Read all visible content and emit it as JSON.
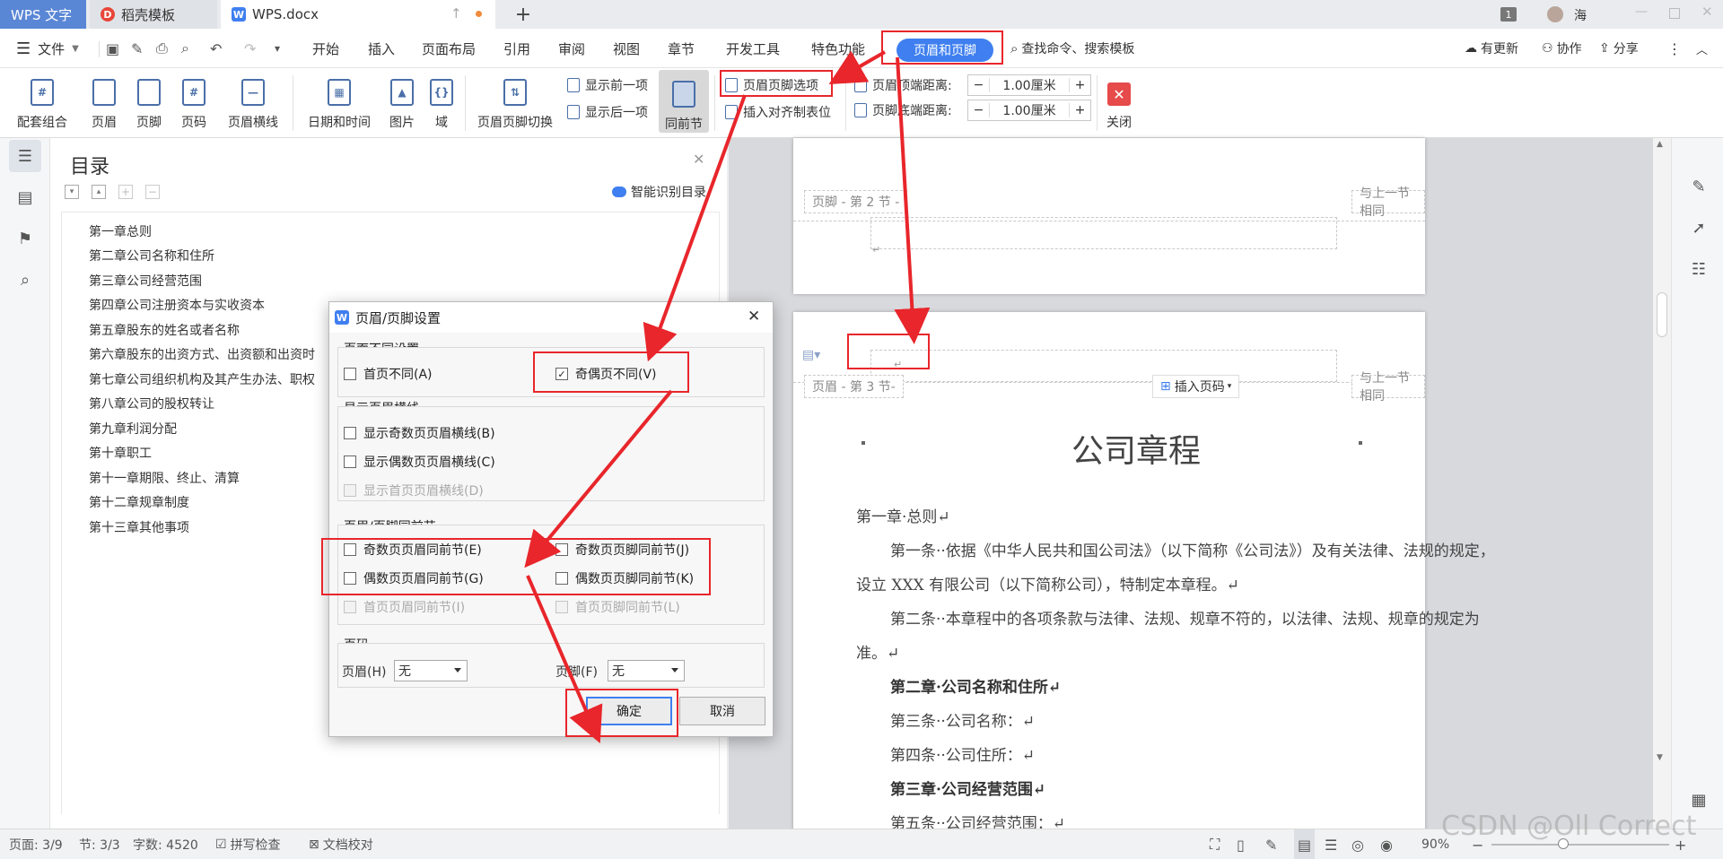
{
  "titlebar": {
    "tabs": [
      {
        "label": "WPS 文字"
      },
      {
        "label": "稻壳模板"
      },
      {
        "label": "WPS.docx"
      }
    ],
    "notification_count": "1",
    "user_name": "海"
  },
  "menubar": {
    "file_label": "文件",
    "items": [
      "开始",
      "插入",
      "页面布局",
      "引用",
      "审阅",
      "视图",
      "章节",
      "开发工具",
      "特色功能"
    ],
    "active_item": "页眉和页脚",
    "search_label": "查找命令、搜索模板",
    "update_label": "有更新",
    "collab_label": "协作",
    "share_label": "分享"
  },
  "ribbon": {
    "config_combo": "配套组合",
    "header": "页眉",
    "footer": "页脚",
    "page_number": "页码",
    "header_line": "页眉横线",
    "date_time": "日期和时间",
    "picture": "图片",
    "field": "域",
    "switch": "页眉页脚切换",
    "show_prev": "显示前一项",
    "show_next": "显示后一项",
    "same_as_prev": "同前节",
    "hf_options": "页眉页脚选项",
    "insert_align_tab": "插入对齐制表位",
    "header_top_label": "页眉顶端距离:",
    "header_top_value": "1.00厘米",
    "footer_bottom_label": "页脚底端距离:",
    "footer_bottom_value": "1.00厘米",
    "close": "关闭"
  },
  "toc": {
    "title": "目录",
    "smart_label": "智能识别目录",
    "items": [
      "第一章总则",
      "第二章公司名称和住所",
      "第三章公司经营范围",
      "第四章公司注册资本与实收资本",
      "第五章股东的姓名或者名称",
      "第六章股东的出资方式、出资额和出资时",
      "第七章公司组织机构及其产生办法、职权",
      "第八章公司的股权转让",
      "第九章利润分配",
      "第十章职工",
      "第十一章期限、终止、清算",
      "第十二章规章制度",
      "第十三章其他事项"
    ]
  },
  "document": {
    "footer_label": "页脚 - 第 2 节 -",
    "same_as_prev_label": "与上一节相同",
    "header_label": "页眉 - 第 3 节-",
    "insert_page_number": "插入页码",
    "para_mark": "↵",
    "title": "公司章程",
    "lines": [
      "第一章·总则↵",
      "第一条··依据《中华人民共和国公司法》（以下简称《公司法》）及有关法律、法规的规定，",
      "设立 XXX 有限公司（以下简称公司），特制定本章程。↵",
      "第二条··本章程中的各项条款与法律、法规、规章不符的，以法律、法规、规章的规定为",
      "准。↵",
      "第二章·公司名称和住所↵",
      "第三条··公司名称：↵",
      "第四条··公司住所：↵",
      "第三章·公司经营范围↵",
      "第五条··公司经营范围：↵"
    ]
  },
  "dialog": {
    "title": "页眉/页脚设置",
    "group_diff": "页面不同设置",
    "first_page_diff": "首页不同(A)",
    "odd_even_diff": "奇偶页不同(V)",
    "group_lines": "显示页眉横线",
    "show_odd_line": "显示奇数页页眉横线(B)",
    "show_even_line": "显示偶数页页眉横线(C)",
    "show_first_line": "显示首页页眉横线(D)",
    "group_same": "页眉/页脚同前节",
    "odd_header_same": "奇数页页眉同前节(E)",
    "odd_footer_same": "奇数页页脚同前节(J)",
    "even_header_same": "偶数页页眉同前节(G)",
    "even_footer_same": "偶数页页脚同前节(K)",
    "first_header_same": "首页页眉同前节(I)",
    "first_footer_same": "首页页脚同前节(L)",
    "group_pagenum": "页码",
    "header_pn_label": "页眉(H)",
    "header_pn_value": "无",
    "footer_pn_label": "页脚(F)",
    "footer_pn_value": "无",
    "ok": "确定",
    "cancel": "取消",
    "checked_mark": "✓"
  },
  "statusbar": {
    "page": "页面: 3/9",
    "section": "节: 3/3",
    "words": "字数: 4520",
    "spellcheck": "拼写检查",
    "proofread": "文档校对",
    "zoom": "90%"
  },
  "watermark": "CSDN @Oll Correct",
  "colors": {
    "accent": "#3f7ff0",
    "annotation": "#e8262b",
    "wps_blue": "#5a86d6"
  }
}
